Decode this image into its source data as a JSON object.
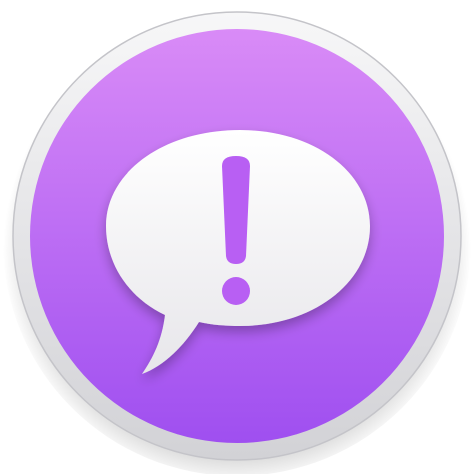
{
  "icon": {
    "depicts": "feedback-assistant-app-icon",
    "colors": {
      "background": "#ffffff",
      "ring_light": "#f7f7f8",
      "ring_dark": "#d2d2d6",
      "purple_light": "#d98bf7",
      "purple_dark": "#9f4ff0",
      "bubble_light": "#ffffff",
      "bubble_dark": "#e7e6ea",
      "exclamation": "#b85ff3"
    }
  }
}
